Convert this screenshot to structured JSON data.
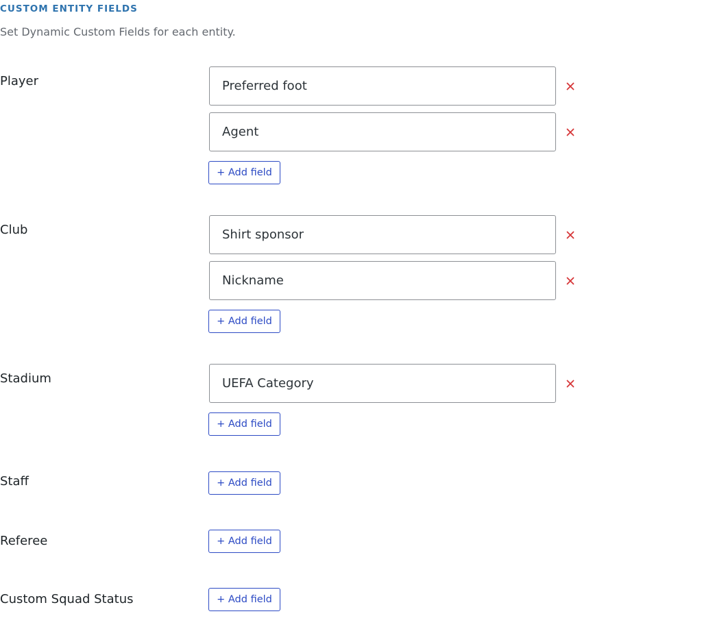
{
  "section": {
    "title": "CUSTOM ENTITY FIELDS",
    "description": "Set Dynamic Custom Fields for each entity."
  },
  "add_field_label": "+ Add field",
  "colors": {
    "title": "#2e73ae",
    "remove": "#d63638",
    "add_button": "#2c4ac4"
  },
  "entities": {
    "player": {
      "label": "Player",
      "fields": [
        "Preferred foot",
        "Agent"
      ]
    },
    "club": {
      "label": "Club",
      "fields": [
        "Shirt sponsor",
        "Nickname"
      ]
    },
    "stadium": {
      "label": "Stadium",
      "fields": [
        "UEFA Category"
      ]
    },
    "staff": {
      "label": "Staff",
      "fields": []
    },
    "referee": {
      "label": "Referee",
      "fields": []
    },
    "squad_status": {
      "label": "Custom Squad Status",
      "fields": []
    }
  }
}
